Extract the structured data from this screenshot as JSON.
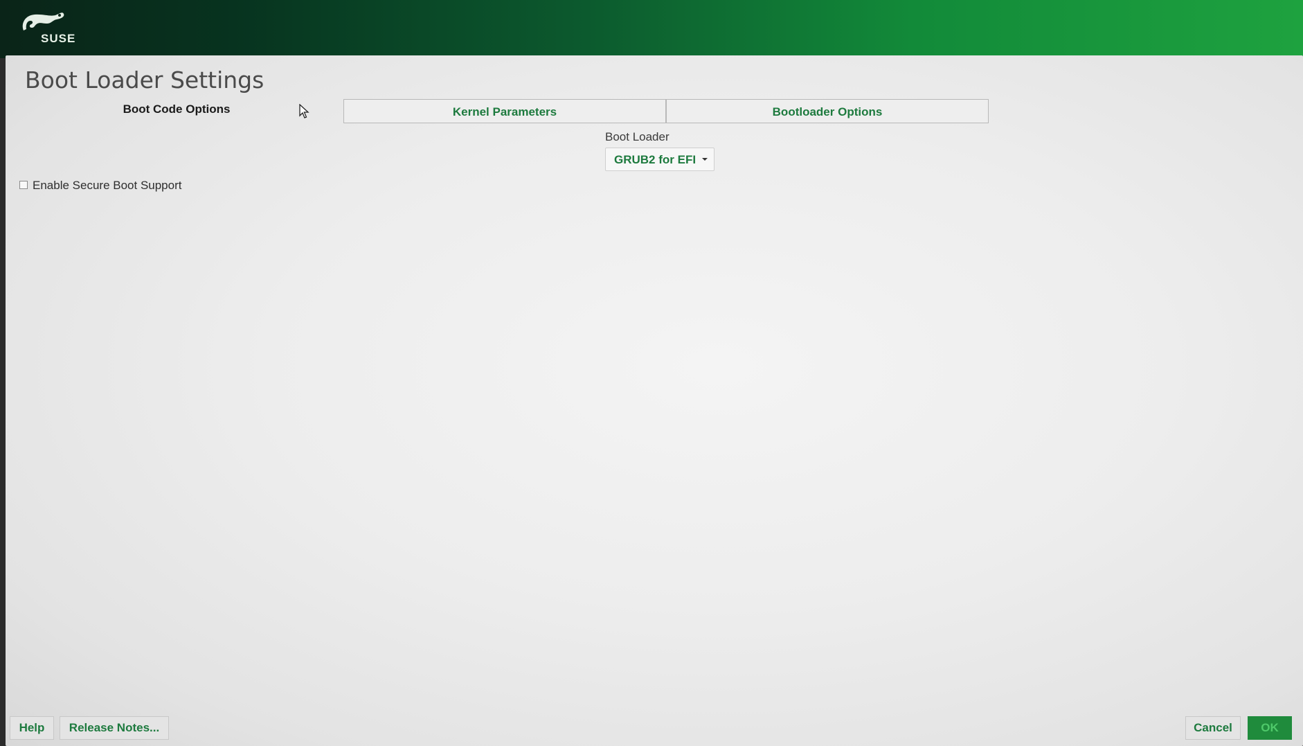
{
  "header": {
    "brand": "SUSE",
    "logo_icon": "suse-chameleon-icon",
    "colors": {
      "dark": "#0a2418",
      "light": "#1ea23f"
    }
  },
  "page": {
    "title": "Boot Loader Settings"
  },
  "tabs": [
    {
      "label": "Boot Code Options",
      "active": true
    },
    {
      "label": "Kernel Parameters",
      "active": false
    },
    {
      "label": "Bootloader Options",
      "active": false
    }
  ],
  "boot_loader": {
    "label": "Boot Loader",
    "selected": "GRUB2 for EFI",
    "dropdown_icon": "chevron-down-icon"
  },
  "secure_boot": {
    "label": "Enable Secure Boot Support",
    "checked": false
  },
  "buttons": {
    "help": "Help",
    "release_notes": "Release Notes...",
    "cancel": "Cancel",
    "ok": "OK"
  },
  "accent_color": "#1d7a3e"
}
